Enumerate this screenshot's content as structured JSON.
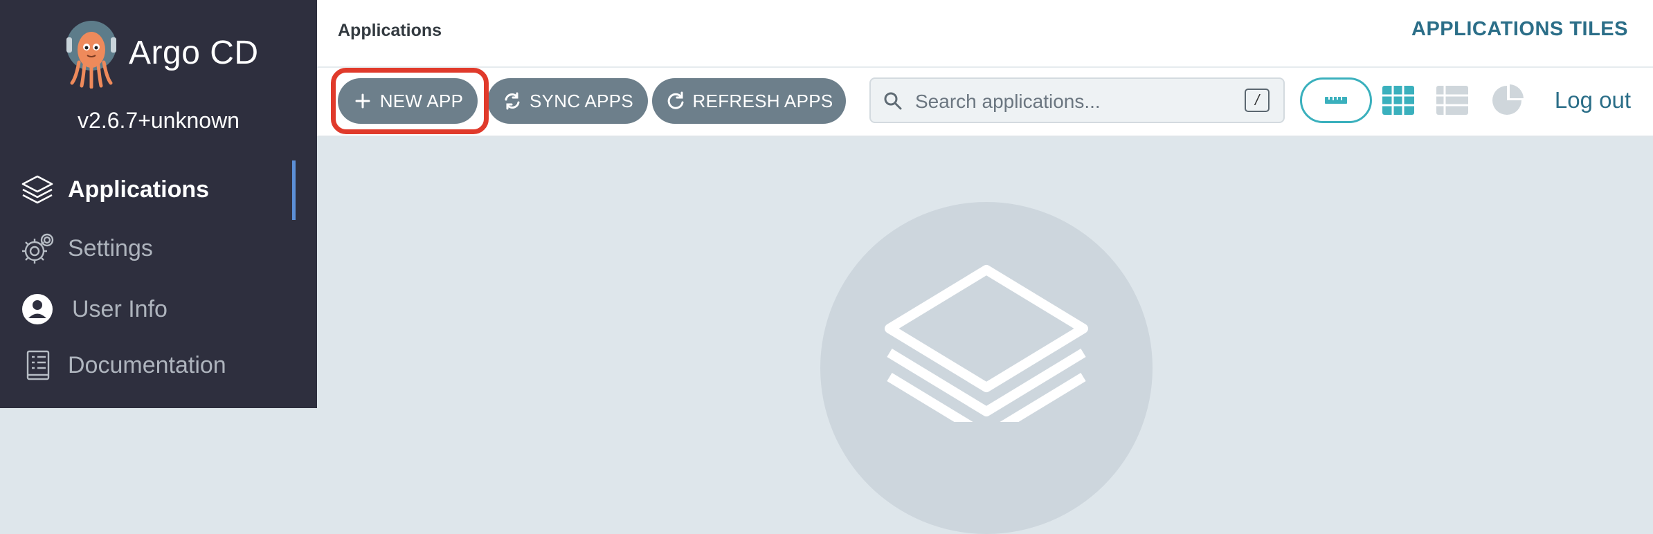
{
  "sidebar": {
    "brand": "Argo CD",
    "version": "v2.6.7+unknown",
    "items": [
      {
        "label": "Applications",
        "icon": "layers-icon",
        "active": true
      },
      {
        "label": "Settings",
        "icon": "gear-icon",
        "active": false
      },
      {
        "label": "User Info",
        "icon": "user-circle-icon",
        "active": false
      },
      {
        "label": "Documentation",
        "icon": "book-icon",
        "active": false
      }
    ]
  },
  "header": {
    "title": "Applications",
    "right_title": "APPLICATIONS TILES"
  },
  "toolbar": {
    "new_app": "NEW APP",
    "sync_apps": "SYNC APPS",
    "refresh_apps": "REFRESH APPS",
    "search_placeholder": "Search applications...",
    "search_shortcut": "/",
    "logout": "Log out"
  },
  "colors": {
    "sidebar_bg": "#2e2f3e",
    "button_bg": "#6d7f8b",
    "accent_teal": "#3ab0bd",
    "highlight_red": "#e03a2b",
    "content_bg": "#dee6eb"
  }
}
